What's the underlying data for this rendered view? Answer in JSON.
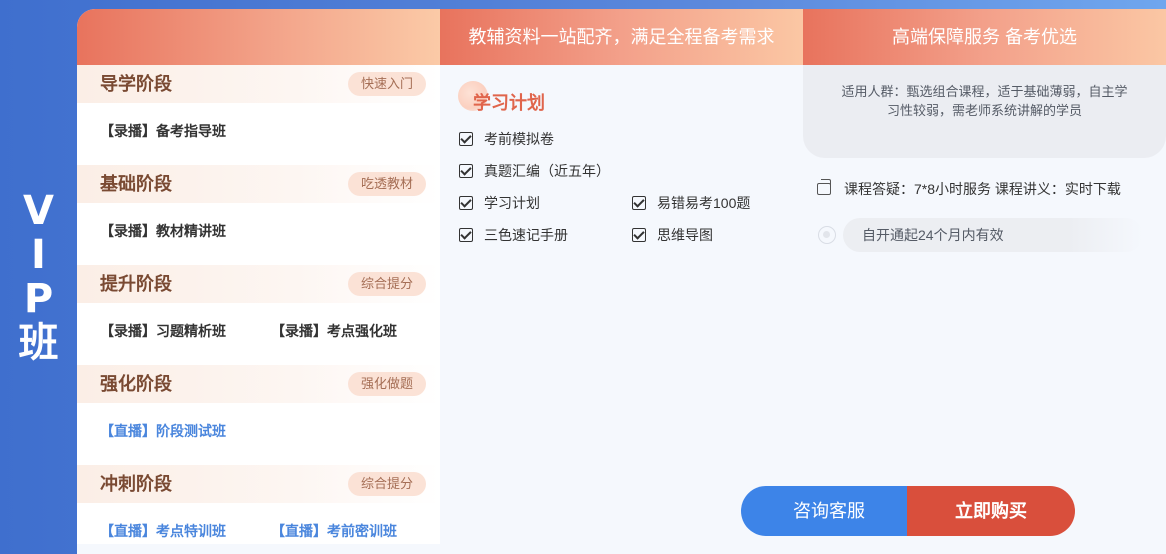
{
  "vip": {
    "line1": "V",
    "line2": "I",
    "line3": "P",
    "line4": "班"
  },
  "header": {
    "col2_title": "教辅资料一站配齐，满足全程备考需求",
    "col3_title": "高端保障服务 备考优选"
  },
  "stages": [
    {
      "title": "导学阶段",
      "tag": "快速入门",
      "courses": [
        {
          "label": "【录播】备考指导班",
          "type": "recorded"
        }
      ]
    },
    {
      "title": "基础阶段",
      "tag": "吃透教材",
      "courses": [
        {
          "label": "【录播】教材精讲班",
          "type": "recorded"
        }
      ]
    },
    {
      "title": "提升阶段",
      "tag": "综合提分",
      "courses": [
        {
          "label": "【录播】习题精析班",
          "type": "recorded"
        },
        {
          "label": "【录播】考点强化班",
          "type": "recorded"
        }
      ]
    },
    {
      "title": "强化阶段",
      "tag": "强化做题",
      "courses": [
        {
          "label": "【直播】阶段测试班",
          "type": "live"
        }
      ]
    },
    {
      "title": "冲刺阶段",
      "tag": "综合提分",
      "courses": [
        {
          "label": "【直播】考点特训班",
          "type": "live"
        },
        {
          "label": "【直播】考前密训班",
          "type": "live"
        }
      ]
    }
  ],
  "plan": {
    "title": "学习计划",
    "items": [
      "考前模拟卷",
      "真题汇编（近五年）",
      "学习计划",
      "易错易考100题",
      "三色速记手册",
      "思维导图"
    ]
  },
  "service": {
    "audience": "适用人群：甄选组合课程，适于基础薄弱，自主学习性较弱，需老师系统讲解的学员",
    "features": "课程答疑：7*8小时服务 课程讲义：实时下载",
    "validity": "自开通起24个月内有效"
  },
  "buttons": {
    "consult": "咨询客服",
    "buy": "立即购买"
  }
}
